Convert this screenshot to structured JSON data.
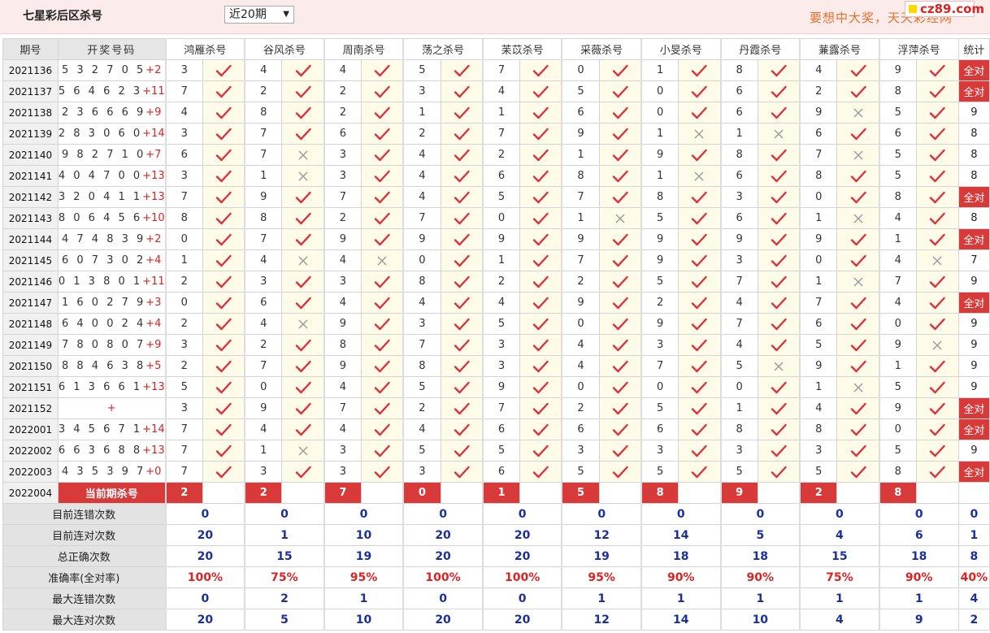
{
  "header": {
    "title": "七星彩后区杀号",
    "period_select": "近20期",
    "slogan": "要想中大奖，天天彩经网",
    "logo": "cz89.com"
  },
  "columns": [
    "期号",
    "开奖号码",
    "鸿雁杀号",
    "谷风杀号",
    "周南杀号",
    "荡之杀号",
    "苿苡杀号",
    "采薇杀号",
    "小旻杀号",
    "丹霞杀号",
    "蒹露杀号",
    "浮萍杀号",
    "统计"
  ],
  "all_right_label": "全对",
  "rows": [
    {
      "id": "2021136",
      "digits": "5 3 2 7 0 5",
      "plus": "+2",
      "kills": [
        3,
        4,
        4,
        5,
        7,
        0,
        1,
        8,
        4,
        9
      ],
      "ok": [
        1,
        1,
        1,
        1,
        1,
        1,
        1,
        1,
        1,
        1
      ],
      "stat": "全对"
    },
    {
      "id": "2021137",
      "digits": "5 6 4 6 2 3",
      "plus": "+11",
      "kills": [
        7,
        2,
        2,
        3,
        4,
        5,
        0,
        6,
        2,
        8
      ],
      "ok": [
        1,
        1,
        1,
        1,
        1,
        1,
        1,
        1,
        1,
        1
      ],
      "stat": "全对"
    },
    {
      "id": "2021138",
      "digits": "2 3 6 6 6 9",
      "plus": "+9",
      "kills": [
        4,
        8,
        2,
        1,
        1,
        6,
        0,
        6,
        9,
        5
      ],
      "ok": [
        1,
        1,
        1,
        1,
        1,
        1,
        1,
        1,
        0,
        1
      ],
      "stat": "9"
    },
    {
      "id": "2021139",
      "digits": "2 8 3 0 6 0",
      "plus": "+14",
      "kills": [
        3,
        7,
        6,
        2,
        7,
        9,
        1,
        1,
        6,
        6
      ],
      "ok": [
        1,
        1,
        1,
        1,
        1,
        1,
        0,
        0,
        1,
        1
      ],
      "stat": "8"
    },
    {
      "id": "2021140",
      "digits": "9 8 2 7 1 0",
      "plus": "+7",
      "kills": [
        6,
        7,
        3,
        4,
        2,
        1,
        9,
        8,
        7,
        5
      ],
      "ok": [
        1,
        0,
        1,
        1,
        1,
        1,
        1,
        1,
        0,
        1
      ],
      "stat": "8"
    },
    {
      "id": "2021141",
      "digits": "4 0 4 7 0 0",
      "plus": "+13",
      "kills": [
        3,
        1,
        3,
        4,
        6,
        8,
        1,
        6,
        8,
        5
      ],
      "ok": [
        1,
        0,
        1,
        1,
        1,
        1,
        0,
        1,
        1,
        1
      ],
      "stat": "8"
    },
    {
      "id": "2021142",
      "digits": "3 2 0 4 1 1",
      "plus": "+13",
      "kills": [
        7,
        9,
        7,
        4,
        5,
        7,
        8,
        3,
        0,
        8
      ],
      "ok": [
        1,
        1,
        1,
        1,
        1,
        1,
        1,
        1,
        1,
        1
      ],
      "stat": "全对"
    },
    {
      "id": "2021143",
      "digits": "8 0 6 4 5 6",
      "plus": "+10",
      "kills": [
        8,
        8,
        2,
        7,
        0,
        1,
        5,
        6,
        1,
        4
      ],
      "ok": [
        1,
        1,
        1,
        1,
        1,
        0,
        1,
        1,
        0,
        1
      ],
      "stat": "8"
    },
    {
      "id": "2021144",
      "digits": "4 7 4 8 3 9",
      "plus": "+2",
      "kills": [
        0,
        7,
        9,
        9,
        9,
        9,
        9,
        9,
        9,
        1
      ],
      "ok": [
        1,
        1,
        1,
        1,
        1,
        1,
        1,
        1,
        1,
        1
      ],
      "stat": "全对"
    },
    {
      "id": "2021145",
      "digits": "6 0 7 3 0 2",
      "plus": "+4",
      "kills": [
        1,
        4,
        4,
        0,
        1,
        7,
        9,
        3,
        0,
        4
      ],
      "ok": [
        1,
        0,
        0,
        1,
        1,
        1,
        1,
        1,
        1,
        0
      ],
      "stat": "7"
    },
    {
      "id": "2021146",
      "digits": "0 1 3 8 0 1",
      "plus": "+11",
      "kills": [
        2,
        3,
        3,
        8,
        2,
        2,
        5,
        7,
        1,
        7
      ],
      "ok": [
        1,
        1,
        1,
        1,
        1,
        1,
        1,
        1,
        0,
        1
      ],
      "stat": "9"
    },
    {
      "id": "2021147",
      "digits": "1 6 0 2 7 9",
      "plus": "+3",
      "kills": [
        0,
        6,
        4,
        4,
        4,
        9,
        2,
        4,
        7,
        4
      ],
      "ok": [
        1,
        1,
        1,
        1,
        1,
        1,
        1,
        1,
        1,
        1
      ],
      "stat": "全对"
    },
    {
      "id": "2021148",
      "digits": "6 4 0 0 2 4",
      "plus": "+4",
      "kills": [
        2,
        4,
        9,
        3,
        5,
        0,
        9,
        7,
        6,
        0
      ],
      "ok": [
        1,
        0,
        1,
        1,
        1,
        1,
        1,
        1,
        1,
        1
      ],
      "stat": "9"
    },
    {
      "id": "2021149",
      "digits": "7 8 0 8 0 7",
      "plus": "+9",
      "kills": [
        3,
        2,
        8,
        7,
        3,
        4,
        3,
        4,
        5,
        9
      ],
      "ok": [
        1,
        1,
        1,
        1,
        1,
        1,
        1,
        1,
        1,
        0
      ],
      "stat": "9"
    },
    {
      "id": "2021150",
      "digits": "8 8 4 6 3 8",
      "plus": "+5",
      "kills": [
        2,
        7,
        9,
        8,
        3,
        4,
        7,
        5,
        9,
        1
      ],
      "ok": [
        1,
        1,
        1,
        1,
        1,
        1,
        1,
        0,
        1,
        1
      ],
      "stat": "9"
    },
    {
      "id": "2021151",
      "digits": "6 1 3 6 6 1",
      "plus": "+13",
      "kills": [
        5,
        0,
        4,
        5,
        9,
        0,
        0,
        0,
        1,
        5
      ],
      "ok": [
        1,
        1,
        1,
        1,
        1,
        1,
        1,
        1,
        0,
        1
      ],
      "stat": "9"
    },
    {
      "id": "2021152",
      "digits": "",
      "plus": "+",
      "kills": [
        3,
        9,
        7,
        2,
        7,
        2,
        5,
        1,
        4,
        9
      ],
      "ok": [
        1,
        1,
        1,
        1,
        1,
        1,
        1,
        1,
        1,
        1
      ],
      "stat": "全对"
    },
    {
      "id": "2022001",
      "digits": "3 4 5 6 7 1",
      "plus": "+14",
      "kills": [
        7,
        4,
        4,
        4,
        6,
        6,
        6,
        8,
        8,
        0
      ],
      "ok": [
        1,
        1,
        1,
        1,
        1,
        1,
        1,
        1,
        1,
        1
      ],
      "stat": "全对"
    },
    {
      "id": "2022002",
      "digits": "6 6 3 6 8 8",
      "plus": "+13",
      "kills": [
        7,
        1,
        3,
        5,
        5,
        3,
        3,
        3,
        3,
        5
      ],
      "ok": [
        1,
        0,
        1,
        1,
        1,
        1,
        1,
        1,
        1,
        1
      ],
      "stat": "9"
    },
    {
      "id": "2022003",
      "digits": "4 3 5 3 9 7",
      "plus": "+0",
      "kills": [
        7,
        3,
        3,
        3,
        6,
        5,
        5,
        5,
        5,
        8
      ],
      "ok": [
        1,
        1,
        1,
        1,
        1,
        1,
        1,
        1,
        1,
        1
      ],
      "stat": "全对"
    }
  ],
  "current": {
    "id": "2022004",
    "label": "当前期杀号",
    "kills": [
      2,
      2,
      7,
      0,
      1,
      5,
      8,
      9,
      2,
      8
    ]
  },
  "stats": [
    {
      "label": "目前连错次数",
      "values": [
        "0",
        "0",
        "0",
        "0",
        "0",
        "0",
        "0",
        "0",
        "0",
        "0"
      ],
      "total": "0"
    },
    {
      "label": "目前连对次数",
      "values": [
        "20",
        "1",
        "10",
        "20",
        "20",
        "12",
        "14",
        "5",
        "4",
        "6"
      ],
      "total": "1"
    },
    {
      "label": "总正确次数",
      "values": [
        "20",
        "15",
        "19",
        "20",
        "20",
        "19",
        "18",
        "18",
        "15",
        "18"
      ],
      "total": "8"
    },
    {
      "label": "准确率(全对率)",
      "values": [
        "100%",
        "75%",
        "95%",
        "100%",
        "100%",
        "95%",
        "90%",
        "90%",
        "75%",
        "90%"
      ],
      "total": "40%"
    },
    {
      "label": "最大连错次数",
      "values": [
        "0",
        "2",
        "1",
        "0",
        "0",
        "1",
        "1",
        "1",
        "1",
        "1"
      ],
      "total": "4"
    },
    {
      "label": "最大连对次数",
      "values": [
        "20",
        "5",
        "10",
        "20",
        "20",
        "12",
        "14",
        "10",
        "4",
        "9"
      ],
      "total": "2"
    }
  ],
  "colors": {
    "accent_red": "#d83a3a",
    "check_red": "#e0303a",
    "stat_blue": "#1a2fa0",
    "header_bg": "#fcebeb"
  },
  "icons": {
    "correct": "check-icon",
    "wrong": "cross-icon"
  }
}
